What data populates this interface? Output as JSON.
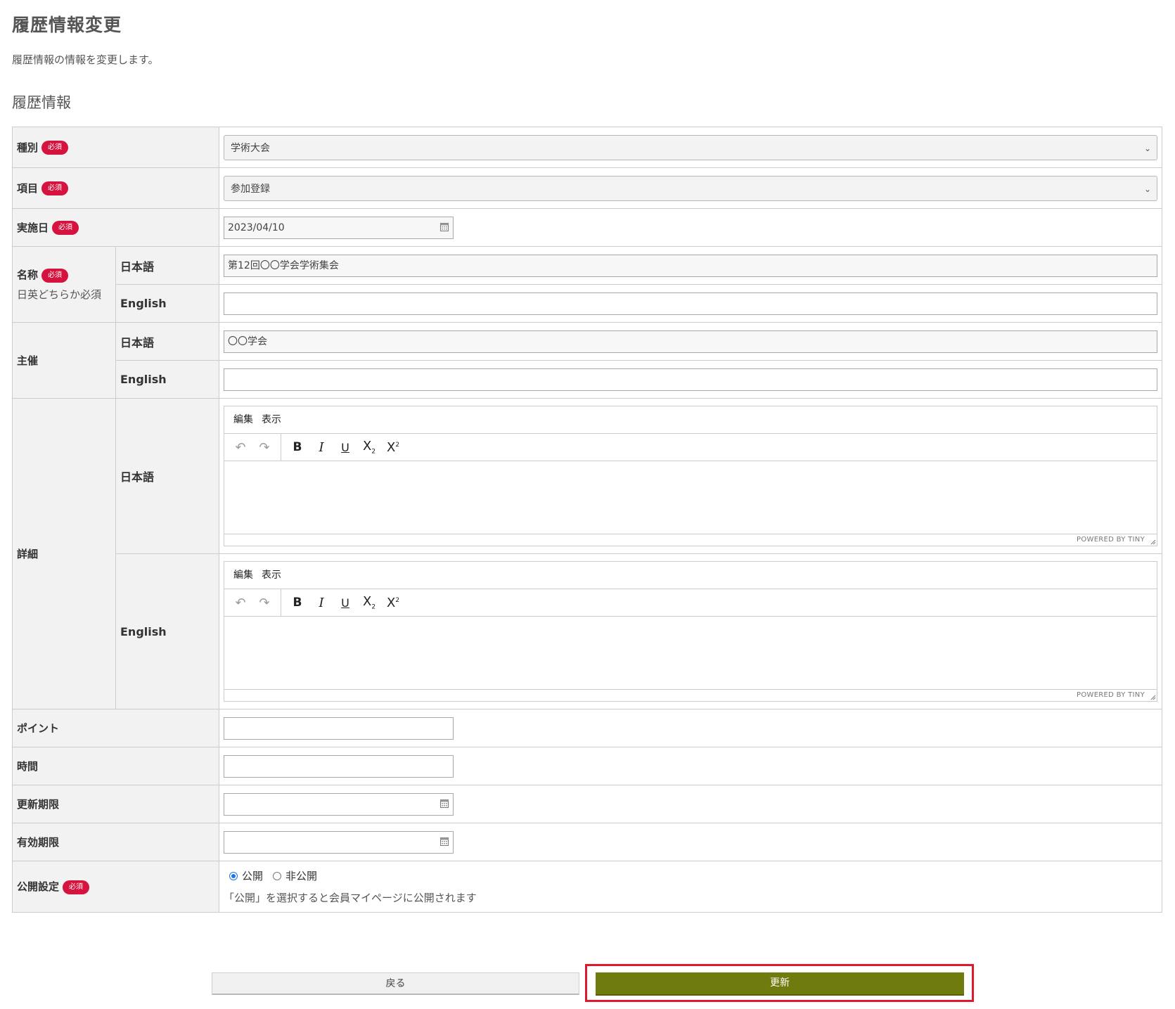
{
  "page": {
    "title": "履歴情報変更",
    "description": "履歴情報の情報を変更します。",
    "section_title": "履歴情報"
  },
  "required_badge": "必須",
  "form": {
    "type": {
      "label": "種別",
      "value": "学術大会"
    },
    "item": {
      "label": "項目",
      "value": "参加登録"
    },
    "date": {
      "label": "実施日",
      "value": "2023/04/10"
    },
    "name": {
      "label": "名称",
      "note": "日英どちらか必須",
      "ja_label": "日本語",
      "ja_value": "第12回〇〇学会学術集会",
      "en_label": "English",
      "en_value": ""
    },
    "organizer": {
      "label": "主催",
      "ja_label": "日本語",
      "ja_value": "〇〇学会",
      "en_label": "English",
      "en_value": ""
    },
    "details": {
      "label": "詳細",
      "ja_label": "日本語",
      "en_label": "English"
    },
    "points": {
      "label": "ポイント",
      "value": ""
    },
    "time": {
      "label": "時間",
      "value": ""
    },
    "renewal_deadline": {
      "label": "更新期限",
      "value": ""
    },
    "expiry": {
      "label": "有効期限",
      "value": ""
    },
    "publish": {
      "label": "公開設定",
      "options": [
        "公開",
        "非公開"
      ],
      "selected": "公開",
      "note": "「公開」を選択すると会員マイページに公開されます"
    }
  },
  "editor": {
    "menu_edit": "編集",
    "menu_view": "表示",
    "powered_by": "POWERED BY TINY",
    "tools": [
      "undo-icon",
      "redo-icon",
      "bold-icon",
      "italic-icon",
      "underline-icon",
      "subscript-icon",
      "superscript-icon"
    ]
  },
  "buttons": {
    "back": "戻る",
    "update": "更新"
  },
  "colors": {
    "required_badge": "#d6133e",
    "update_button": "#6f7b0c",
    "highlight_frame": "#e0182d"
  }
}
